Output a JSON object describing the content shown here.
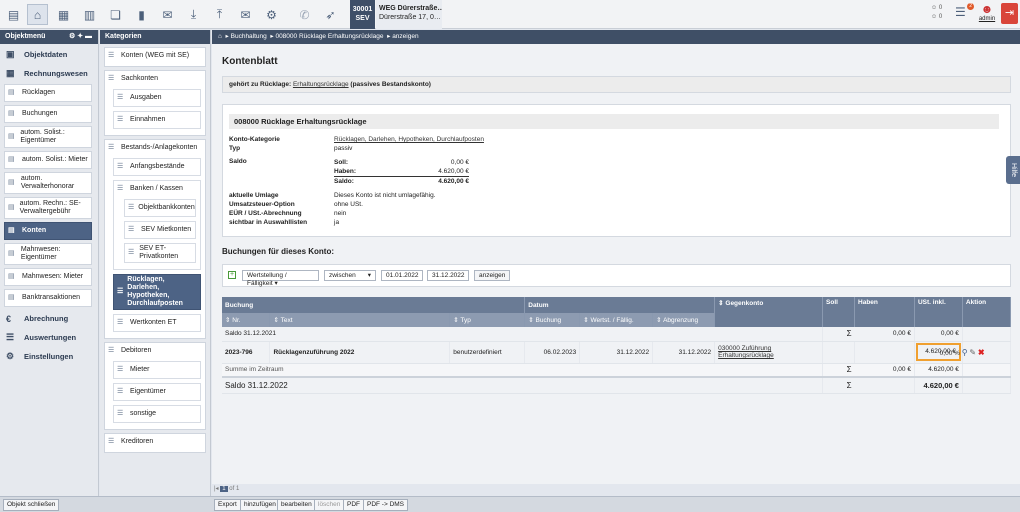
{
  "topbar": {
    "object_number": "30001",
    "object_code": "SEV",
    "object_name": "WEG Dürerstraße…",
    "object_address": "Dürerstraße 17, 0…",
    "counter_a": "0",
    "counter_b": "0",
    "notification_count": "2",
    "user": "admin"
  },
  "leftmenu": {
    "header": "Objektmenü",
    "sections": {
      "objektdaten": "Objektdaten",
      "rechnungswesen": "Rechnungswesen",
      "abrechnung": "Abrechnung",
      "auswertungen": "Auswertungen",
      "einstellungen": "Einstellungen"
    },
    "items": [
      "Rücklagen",
      "Buchungen",
      "autom. Solist.: Eigentümer",
      "autom. Solist.: Mieter",
      "autom. Verwalterhonorar",
      "autom. Rechn.: SE-Verwaltergebühr",
      "Konten",
      "Mahnwesen: Eigentümer",
      "Mahnwesen: Mieter",
      "Banktransaktionen"
    ]
  },
  "categories": {
    "header": "Kategorien",
    "konten_weg": "Konten (WEG mit SE)",
    "sachkonten": "Sachkonten",
    "ausgaben": "Ausgaben",
    "einnahmen": "Einnahmen",
    "bestands": "Bestands-/Anlagekonten",
    "anfangsbestaende": "Anfangsbestände",
    "banken": "Banken / Kassen",
    "objektbank": "Objektbankkonten",
    "sev_miet": "SEV Mietkonten",
    "sev_et": "SEV ET-Privatkonten",
    "ruecklagen": "Rücklagen, Darlehen, Hypotheken, Durchlaufposten",
    "wertkonten": "Wertkonten ET",
    "debitoren": "Debitoren",
    "mieter": "Mieter",
    "eigentuemer": "Eigentümer",
    "sonstige": "sonstige",
    "kreditoren": "Kreditoren"
  },
  "breadcrumb": {
    "home": "⌂",
    "b1": "Buchhaltung",
    "b2": "008000 Rücklage Erhaltungsrücklage",
    "b3": "anzeigen"
  },
  "main": {
    "title": "Kontenblatt",
    "belongs_prefix": "gehört zu Rücklage:",
    "belongs_link": "Erhaltungsrücklage",
    "belongs_suffix": "(passives Bestandskonto)",
    "account_title": "008000 Rücklage Erhaltungsrücklage",
    "kategorie_label": "Konto-Kategorie",
    "kategorie_value": "Rücklagen, Darlehen, Hypotheken, Durchlaufposten",
    "typ_label": "Typ",
    "typ_value": "passiv",
    "saldo_label": "Saldo",
    "soll_label": "Soll:",
    "soll_value": "0,00 €",
    "haben_label": "Haben:",
    "haben_value": "4.620,00 €",
    "saldo_sub_label": "Saldo:",
    "saldo_sub_value": "4.620,00 €",
    "umlage_label": "aktuelle Umlage",
    "umlage_value": "Dieses Konto ist nicht umlagefähig.",
    "ust_option_label": "Umsatzsteuer-Option",
    "ust_option_value": "ohne USt.",
    "eur_label": "EÜR / USt.-Abrechnung",
    "eur_value": "nein",
    "sichtbar_label": "sichtbar in Auswahllisten",
    "sichtbar_value": "ja",
    "buchungen_title": "Buchungen für dieses Konto:"
  },
  "filter": {
    "date_type": "Wertstellung / Fälligkeit",
    "range_type": "zwischen",
    "date_from": "01.01.2022",
    "date_to": "31.12.2022",
    "show_button": "anzeigen"
  },
  "grid": {
    "headers": {
      "buchung": "Buchung",
      "datum": "Datum",
      "gegenkonto": "Gegenkonto",
      "soll": "Soll",
      "haben": "Haben",
      "ust": "USt. inkl.",
      "aktion": "Aktion"
    },
    "subheaders": {
      "nr": "Nr.",
      "text": "Text",
      "typ": "Typ",
      "buchung": "Buchung",
      "wertst": "Wertst. / Fällig.",
      "abgrenzung": "Abgrenzung"
    },
    "saldo_start_label": "Saldo 31.12.2021",
    "saldo_start_soll": "0,00 €",
    "saldo_start_haben": "0,00 €",
    "row": {
      "nr": "2023-796",
      "text": "Rücklagenzuführung 2022",
      "typ": "benutzerdefiniert",
      "buchung": "06.02.2023",
      "wertst": "31.12.2022",
      "abgrenzung": "31.12.2022",
      "gegenkonto": "030000 Zuführung Erhaltungsrücklage",
      "haben": "4.620,00 €",
      "ust": "0,00 %"
    },
    "summe_label": "Summe im Zeitraum",
    "summe_soll": "0,00 €",
    "summe_haben": "4.620,00 €",
    "saldo_end_label": "Saldo 31.12.2022",
    "saldo_end_haben": "4.620,00 €",
    "sigma": "Σ"
  },
  "pager": {
    "current": "1",
    "total": "1"
  },
  "footer": {
    "close": "Objekt schließen",
    "export": "Export",
    "add": "hinzufügen",
    "edit": "bearbeiten",
    "delete": "löschen",
    "pdf": "PDF",
    "pdf_dms": "PDF -> DMS"
  },
  "help_tab": "Hilfe",
  "colors": {
    "header": "#3f4f66",
    "selected": "#4d6385",
    "highlight": "#f0a030"
  }
}
